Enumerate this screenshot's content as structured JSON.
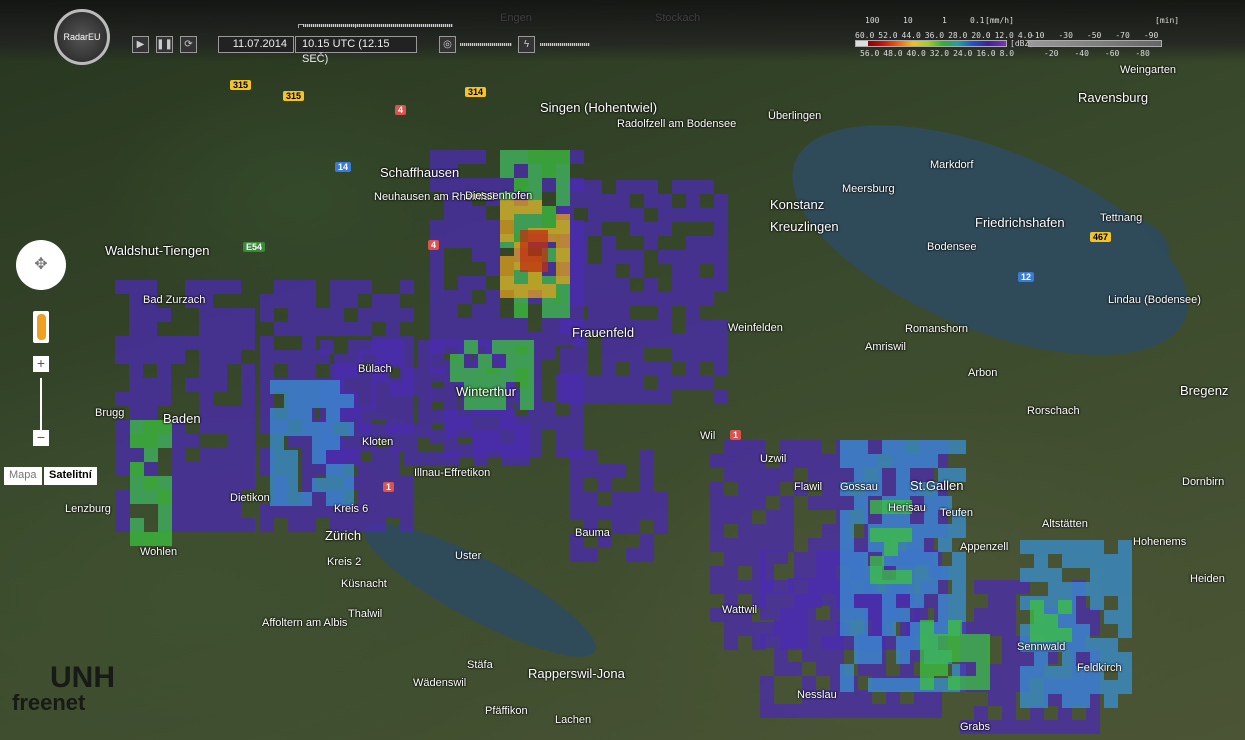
{
  "app": {
    "logo": "RadarEU",
    "date": "11.07.2014",
    "time": "10.15 UTC (12.15 SEČ)"
  },
  "controls": {
    "play": "▶",
    "pause": "❚❚",
    "loop": "⟳",
    "radar_toggle": "◎",
    "lightning_toggle": "ϟ"
  },
  "legend": {
    "rate_ticks": [
      "100",
      "10",
      "1",
      "0.1"
    ],
    "rate_unit": "[mm/h]",
    "dbz_top": [
      "60.0",
      "52.0",
      "44.0",
      "36.0",
      "28.0",
      "20.0",
      "12.0",
      "4.0"
    ],
    "dbz_bottom": [
      "56.0",
      "48.0",
      "40.0",
      "32.0",
      "24.0",
      "16.0",
      "8.0"
    ],
    "dbz_unit": "[dBZ]",
    "lightning_top": [
      "-10",
      "-30",
      "-50",
      "-70",
      "-90"
    ],
    "lightning_bottom": [
      "-20",
      "-40",
      "-60",
      "-80"
    ],
    "lightning_unit": "[min]"
  },
  "map_controls": {
    "zoom_in": "+",
    "zoom_out": "−",
    "map_type_map": "Mapa",
    "map_type_satellite": "Satelitní"
  },
  "watermark": {
    "line1": "UNH",
    "line2": "freenet"
  },
  "places": [
    "Schaffhausen",
    "Singen (Hohentwiel)",
    "Radolfzell am Bodensee",
    "Konstanz",
    "Kreuzlingen",
    "Bodensee",
    "Friedrichshafen",
    "Ravensburg",
    "Lindau (Bodensee)",
    "Bregenz",
    "Dornbirn",
    "Waldshut-Tiengen",
    "Bad Zurzach",
    "Baden",
    "Brugg",
    "Bülach",
    "Kloten",
    "Winterthur",
    "Frauenfeld",
    "Weinfelden",
    "Romanshorn",
    "Arbon",
    "Rorschach",
    "St.Gallen",
    "Herisau",
    "Gossau",
    "Wil",
    "Uster",
    "Zürich",
    "Wohlen",
    "Lenzburg",
    "Dietikon",
    "Rapperswil-Jona",
    "Wattwil",
    "Appenzell",
    "Altstätten",
    "Feldkirch",
    "Hohenems",
    "Meersburg",
    "Tettnang",
    "Markdorf",
    "Uzwil",
    "Stäfa",
    "Wädenswil",
    "Thalwil",
    "Küsnacht",
    "Affoltern am Albis",
    "Lachen",
    "Nesslau",
    "Sennwald",
    "Grabs",
    "Pfäffikon",
    "Illnau-Effretikon",
    "Stockach",
    "Überlingen",
    "Neuhausen am Rheinfall",
    "Diessenhofen",
    "Kreis 6",
    "Kreis 2",
    "Bauma",
    "Flawil",
    "Teufen",
    "Amriswil",
    "Engen",
    "Weingarten",
    "Heiden"
  ],
  "colors": {
    "rain_low": "#4b2bb0",
    "rain_mid": "#3a8fd0",
    "rain_green": "#3cc040",
    "rain_high": "#e0a020",
    "rain_peak": "#c03010"
  }
}
